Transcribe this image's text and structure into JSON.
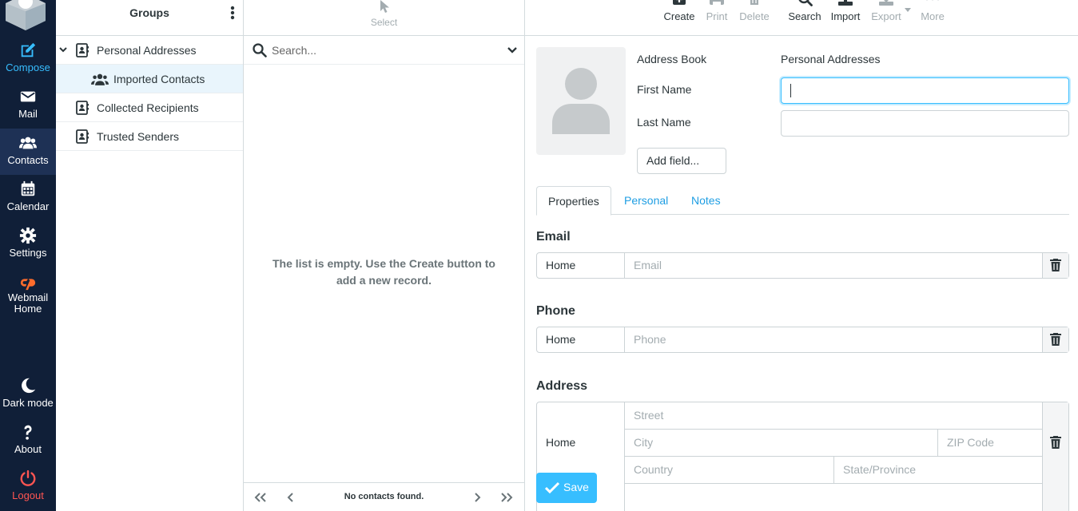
{
  "nav": {
    "compose": "Compose",
    "mail": "Mail",
    "contacts": "Contacts",
    "calendar": "Calendar",
    "settings": "Settings",
    "webmail_line1": "Webmail",
    "webmail_line2": "Home",
    "dark_mode": "Dark mode",
    "about": "About",
    "logout": "Logout",
    "accent_color": "#37beff",
    "logout_color": "#ff5552"
  },
  "groups": {
    "title": "Groups",
    "items": [
      {
        "label": "Personal Addresses",
        "icon": "address-book-icon"
      },
      {
        "label": "Imported Contacts",
        "icon": "users-icon"
      },
      {
        "label": "Collected Recipients",
        "icon": "address-book-icon"
      },
      {
        "label": "Trusted Senders",
        "icon": "address-book-icon"
      }
    ]
  },
  "list": {
    "select_label": "Select",
    "search_placeholder": "Search...",
    "empty_line1": "The list is empty. Use the Create button to",
    "empty_line2": "add a new record.",
    "footer": "No contacts found."
  },
  "toolbar": {
    "create": "Create",
    "print": "Print",
    "delete": "Delete",
    "search": "Search",
    "import": "Import",
    "export": "Export",
    "more": "More"
  },
  "form": {
    "address_book_label": "Address Book",
    "address_book_value": "Personal Addresses",
    "first_name_label": "First Name",
    "first_name_value": "",
    "last_name_label": "Last Name",
    "last_name_value": "",
    "add_field": "Add field...",
    "tabs": [
      "Properties",
      "Personal",
      "Notes"
    ],
    "email_title": "Email",
    "email_type": "Home",
    "email_placeholder": "Email",
    "phone_title": "Phone",
    "phone_type": "Home",
    "phone_placeholder": "Phone",
    "address_title": "Address",
    "address_type": "Home",
    "street_placeholder": "Street",
    "city_placeholder": "City",
    "zip_placeholder": "ZIP Code",
    "country_placeholder": "Country",
    "state_placeholder": "State/Province",
    "save": "Save"
  }
}
